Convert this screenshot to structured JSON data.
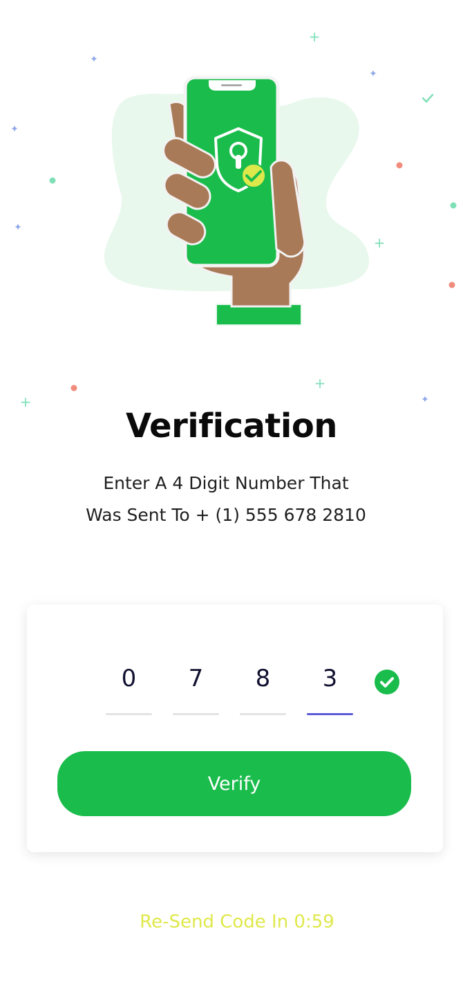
{
  "verification": {
    "title": "Verification",
    "subtitle_line1": "Enter A 4 Digit Number That",
    "subtitle_line2": "Was Sent To + (1) 555 678 2810"
  },
  "code": {
    "digits": [
      "0",
      "7",
      "8",
      "3"
    ],
    "status_icon": "check-circle-icon"
  },
  "actions": {
    "verify_label": "Verify",
    "resend_text": "Re-Send Code In 0:59"
  },
  "colors": {
    "brand": "#1abc4c",
    "active_underline": "#5b5bd8",
    "resend": "#dfe84a",
    "illustration_blob": "#e8f8ec",
    "skin": "#a87a58",
    "shield_check": "#dfe84a"
  },
  "illustration": {
    "icons": [
      "hand-holding-phone",
      "shield-lock-icon",
      "checkmark-badge-icon",
      "confetti-decoration"
    ]
  }
}
